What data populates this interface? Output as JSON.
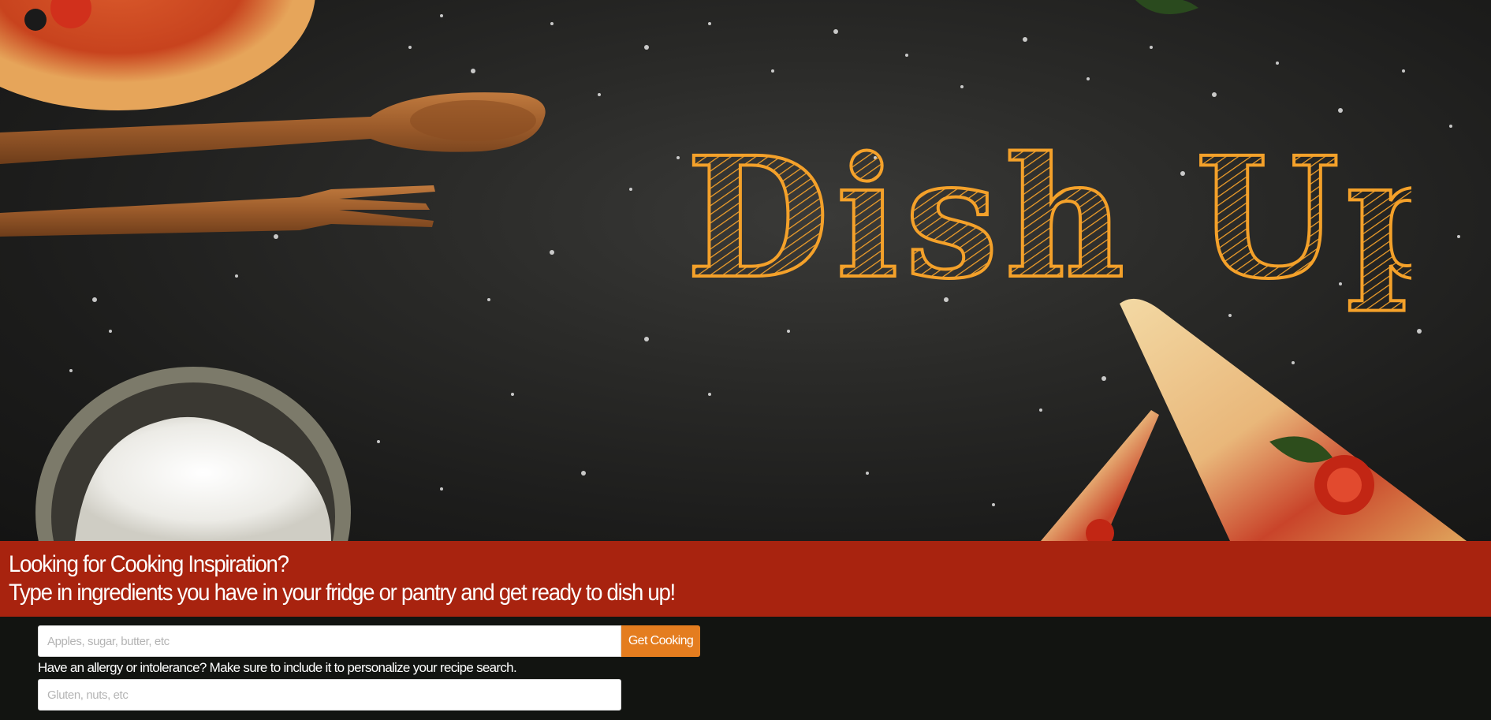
{
  "hero": {
    "logo_text": "Dish Up",
    "logo_color": "#f4a12a"
  },
  "banner": {
    "heading": "Looking for Cooking Inspiration?",
    "subheading": "Type in ingredients you have in your fridge or pantry and get ready to dish up!",
    "background_color": "#a8230f"
  },
  "search": {
    "ingredients_placeholder": "Apples, sugar, butter, etc",
    "submit_label": "Get Cooking",
    "allergy_label": "Have an allergy or intolerance? Make sure to include it to personalize your recipe search.",
    "allergy_placeholder": "Gluten, nuts, etc",
    "button_color": "#e47d1f"
  }
}
